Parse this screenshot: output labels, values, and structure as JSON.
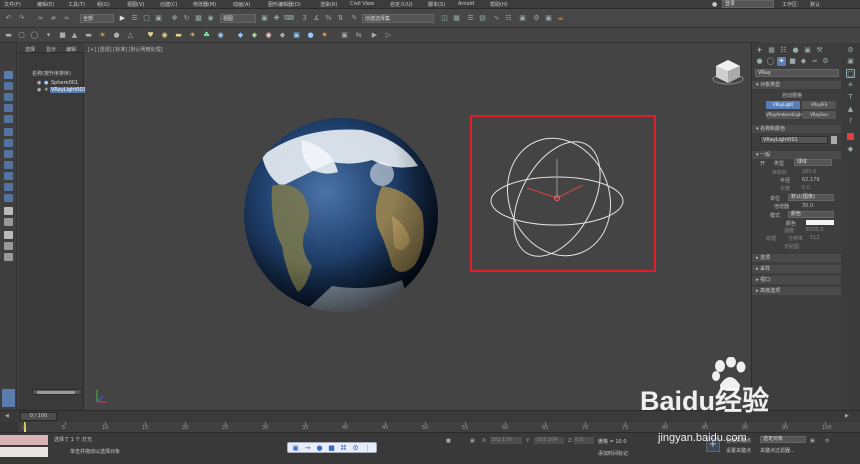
{
  "menu": [
    "文件(F)",
    "编辑(E)",
    "工具(T)",
    "组(G)",
    "视图(V)",
    "创建(C)",
    "修改器(M)",
    "动画(A)",
    "图形编辑器(D)",
    "渲染(R)",
    "Civil View",
    "自定义(U)",
    "脚本(S)",
    "Arnold",
    "帮助(H)"
  ],
  "top_right": {
    "user_select": "登录",
    "workspace_label": "工作区:",
    "workspace_value": "默认"
  },
  "toolbar": {
    "filter_select": "全部",
    "selection_set": "创建选择集",
    "view_select": "视图"
  },
  "scene_explorer": {
    "tabs": [
      "选择",
      "显示",
      "编辑"
    ],
    "header": "名称(按升序排序)",
    "items": [
      {
        "name": "Sphere001"
      },
      {
        "name": "VRayLight001"
      }
    ]
  },
  "viewport": {
    "label": "[+] [透视] [标准] [默认明暗处理]"
  },
  "command_panel": {
    "object_dropdown": "VRay",
    "section_object_type": "对象类型",
    "autogrid": "自动栅格",
    "buttons": [
      "VRayLight",
      "VRayIES",
      "VRayAmbientLight",
      "VRaySun"
    ],
    "section_name_color": "名称和颜色",
    "object_name": "VRayLight001",
    "section_general": "一般",
    "general": {
      "on_label": "开",
      "type_label": "类型",
      "type_value": "球体",
      "target_label": "目标的",
      "target_value": "200.0",
      "radius_label": "半径",
      "radius_value": "62.179",
      "length_label": "长度",
      "length_value": "0.0",
      "units_label": "单位",
      "units_value": "默认(图像)",
      "multiplier_label": "倍增器",
      "multiplier_value": "30.0",
      "mode_label": "模式",
      "mode_value": "颜色",
      "color_label": "颜色",
      "temperature_label": "温度",
      "temperature_value": "6500.0",
      "texture_label": "纹理",
      "resolution_label": "分辨率",
      "resolution_value": "512",
      "texture_none": "无贴图"
    },
    "rollouts": [
      "选项",
      "采样",
      "视口",
      "高级选项"
    ]
  },
  "timeline": {
    "frame": "0 / 100"
  },
  "track_ticks": [
    "0",
    "5",
    "10",
    "15",
    "20",
    "25",
    "30",
    "35",
    "40",
    "45",
    "50",
    "55",
    "60",
    "65",
    "70",
    "75",
    "80",
    "85",
    "90",
    "95",
    "100"
  ],
  "status": {
    "selected": "选择了 1 个 灯光",
    "prompt": "单击并拖动以选择对象",
    "x_label": "X:",
    "x_value": "182.179",
    "y_label": "Y:",
    "y_value": "-102.104",
    "z_label": "Z:",
    "z_value": "0.0",
    "grid": "栅格 = 10.0",
    "add_time_tag": "添加时间标记",
    "auto_key": "自动关键点",
    "set_key": "设置关键点",
    "selected_obj": "选定对象",
    "key_filter": "关键点过滤器..."
  },
  "watermark": {
    "brand": "Baidu经验",
    "url": "jingyan.baidu.com"
  },
  "colors": {
    "accent": "#5a7fb8",
    "highlight_box": "#e01e2a",
    "vray_red": "#e04040"
  }
}
